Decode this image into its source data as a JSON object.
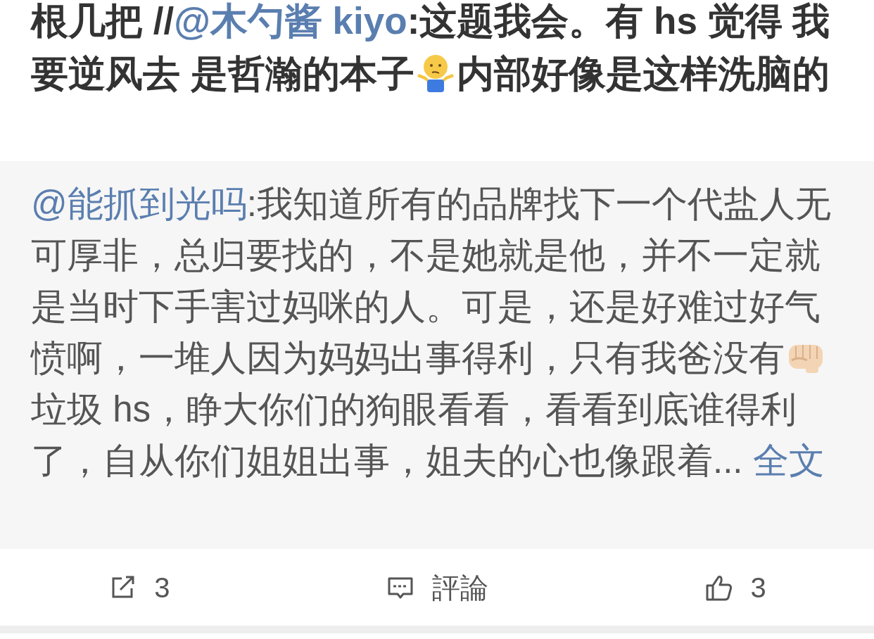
{
  "post": {
    "segments": [
      {
        "kind": "text",
        "text": "根几把 //"
      },
      {
        "kind": "mention",
        "text": "@木勺酱 kiyo"
      },
      {
        "kind": "text",
        "text": ":这题我会。有 hs 觉得 我要逆风去 是哲瀚的本子"
      },
      {
        "kind": "shrug-emoji"
      },
      {
        "kind": "text",
        "text": "内部好像是这样洗脑的"
      }
    ]
  },
  "repost": {
    "segments": [
      {
        "kind": "mention",
        "text": "@能抓到光吗"
      },
      {
        "kind": "text",
        "text": ":我知道所有的品牌找下一个代盐人无可厚非，总归要找的，不是她就是他，并不一定就是当时下手害过妈咪的人。可是，还是好难过好气愤啊，一堆人因为妈妈出事得利，只有我爸没有"
      },
      {
        "kind": "fist-emoji"
      },
      {
        "kind": "break"
      },
      {
        "kind": "text",
        "text": "垃圾 hs，睁大你们的狗眼看看，看看到底谁得利了，自从你们姐姐出事，姐夫的心也像跟着..."
      },
      {
        "kind": "more",
        "text": " 全文"
      }
    ]
  },
  "actions": [
    {
      "kind": "repost",
      "label": "3"
    },
    {
      "kind": "comment",
      "label": "評論"
    },
    {
      "kind": "like",
      "label": "3"
    }
  ]
}
